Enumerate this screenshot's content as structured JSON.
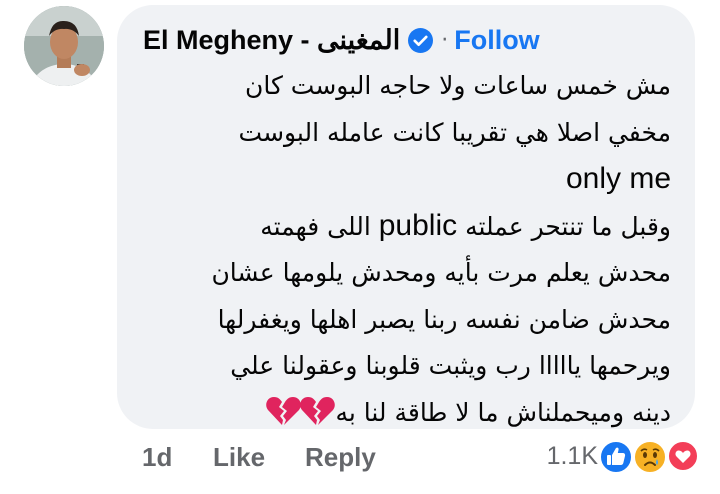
{
  "comment": {
    "author_name": "El Megheny - المغينى",
    "follow_label": "Follow",
    "separator": "·",
    "body_lines": [
      "مش خمس ساعات ولا حاجه البوست كان",
      "مخفي اصلا هي تقريبا كانت عامله البوست",
      "only me",
      "وقبل ما تنتحر عملته public اللى فهمته",
      "محدش يعلم مرت بأيه ومحدش يلومها عشان",
      "محدش ضامن نفسه ربنا يصبر اهلها ويغفرلها",
      "ويرحمها يااااا رب ويثبت قلوبنا وعقولنا علي",
      "دينه وميحملناش ما لا طاقة لنا به"
    ],
    "trailing_emoji": [
      "broken-heart",
      "broken-heart"
    ]
  },
  "footer": {
    "time": "1d",
    "like_label": "Like",
    "reply_label": "Reply",
    "reaction_count": "1.1K",
    "reactions": [
      "like-reaction-icon",
      "sad-reaction-icon",
      "love-reaction-icon"
    ]
  },
  "colors": {
    "bubble": "#f0f2f5",
    "link": "#1877f2",
    "meta": "#65676b",
    "broken_heart": "#e0245e"
  }
}
